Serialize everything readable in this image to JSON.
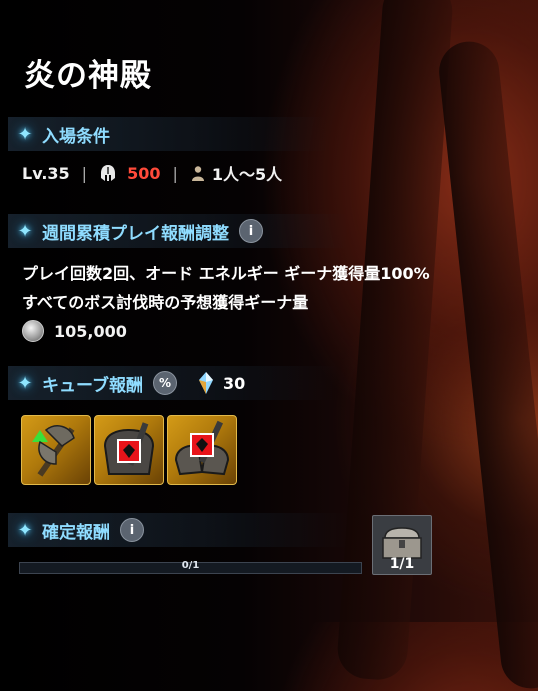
{
  "title": "炎の神殿",
  "entry": {
    "header": "入場条件",
    "level": "Lv.35",
    "power": "500",
    "players": "1人〜5人"
  },
  "weekly": {
    "header": "週間累積プレイ報酬調整",
    "info_icon": "i",
    "line1": "プレイ回数2回、オード エネルギー ギーナ獲得量100%",
    "line2": "すべてのボス討伐時の予想獲得ギーナ量",
    "gina_amount": "105,000"
  },
  "cube": {
    "header": "キューブ報酬",
    "percent_icon": "%",
    "crystal_count": "30",
    "items": [
      {
        "icon": "axe-weapon-icon"
      },
      {
        "icon": "chest-armor-icon"
      },
      {
        "icon": "shoulder-armor-icon"
      }
    ]
  },
  "guaranteed": {
    "header": "確定報酬",
    "info_icon": "i",
    "progress": {
      "current": 0,
      "total": 1,
      "label": "0/1"
    },
    "chest_count": "1/1"
  },
  "colors": {
    "accent": "#8fdcff",
    "power_red": "#ff4a3a",
    "item_gold": "#d39a17"
  }
}
